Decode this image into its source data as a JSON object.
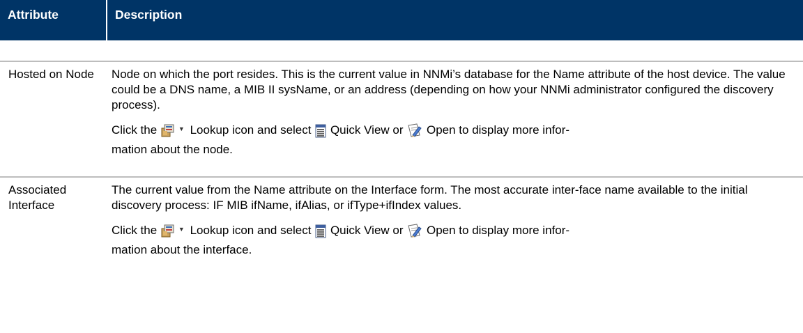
{
  "header": {
    "attribute": "Attribute",
    "description": "Description"
  },
  "rows": [
    {
      "attribute": "Hosted on Node",
      "text1": "Node on which the port resides. This is the current value in NNMi’s database for the Name attribute of the host device. The value could be a DNS name, a MIB II sysName, or an address (depending on how your NNMi administrator configured the discovery process).",
      "click_pre": "Click the",
      "lookup_text": "Lookup icon and select",
      "quickview_text": "Quick View or",
      "open_text": "Open to display more infor-",
      "tail": "mation about the node."
    },
    {
      "attribute": "Associated Interface",
      "text1": "The current value from the Name attribute on the Interface form. The most accurate inter-face name available to the initial discovery process: IF MIB ifName, ifAlias, or ifType+ifIndex values.",
      "click_pre": "Click the",
      "lookup_text": "Lookup icon and select",
      "quickview_text": "Quick View or",
      "open_text": "Open to display more infor-",
      "tail": "mation about the interface."
    }
  ],
  "icons": {
    "lookup": "lookup-icon",
    "dropdown": "dropdown-arrow-icon",
    "quickview": "quick-view-icon",
    "open": "open-form-icon"
  },
  "colors": {
    "header_bg": "#003466",
    "header_text": "#ffffff",
    "row_divider": "#bdbdbd"
  }
}
